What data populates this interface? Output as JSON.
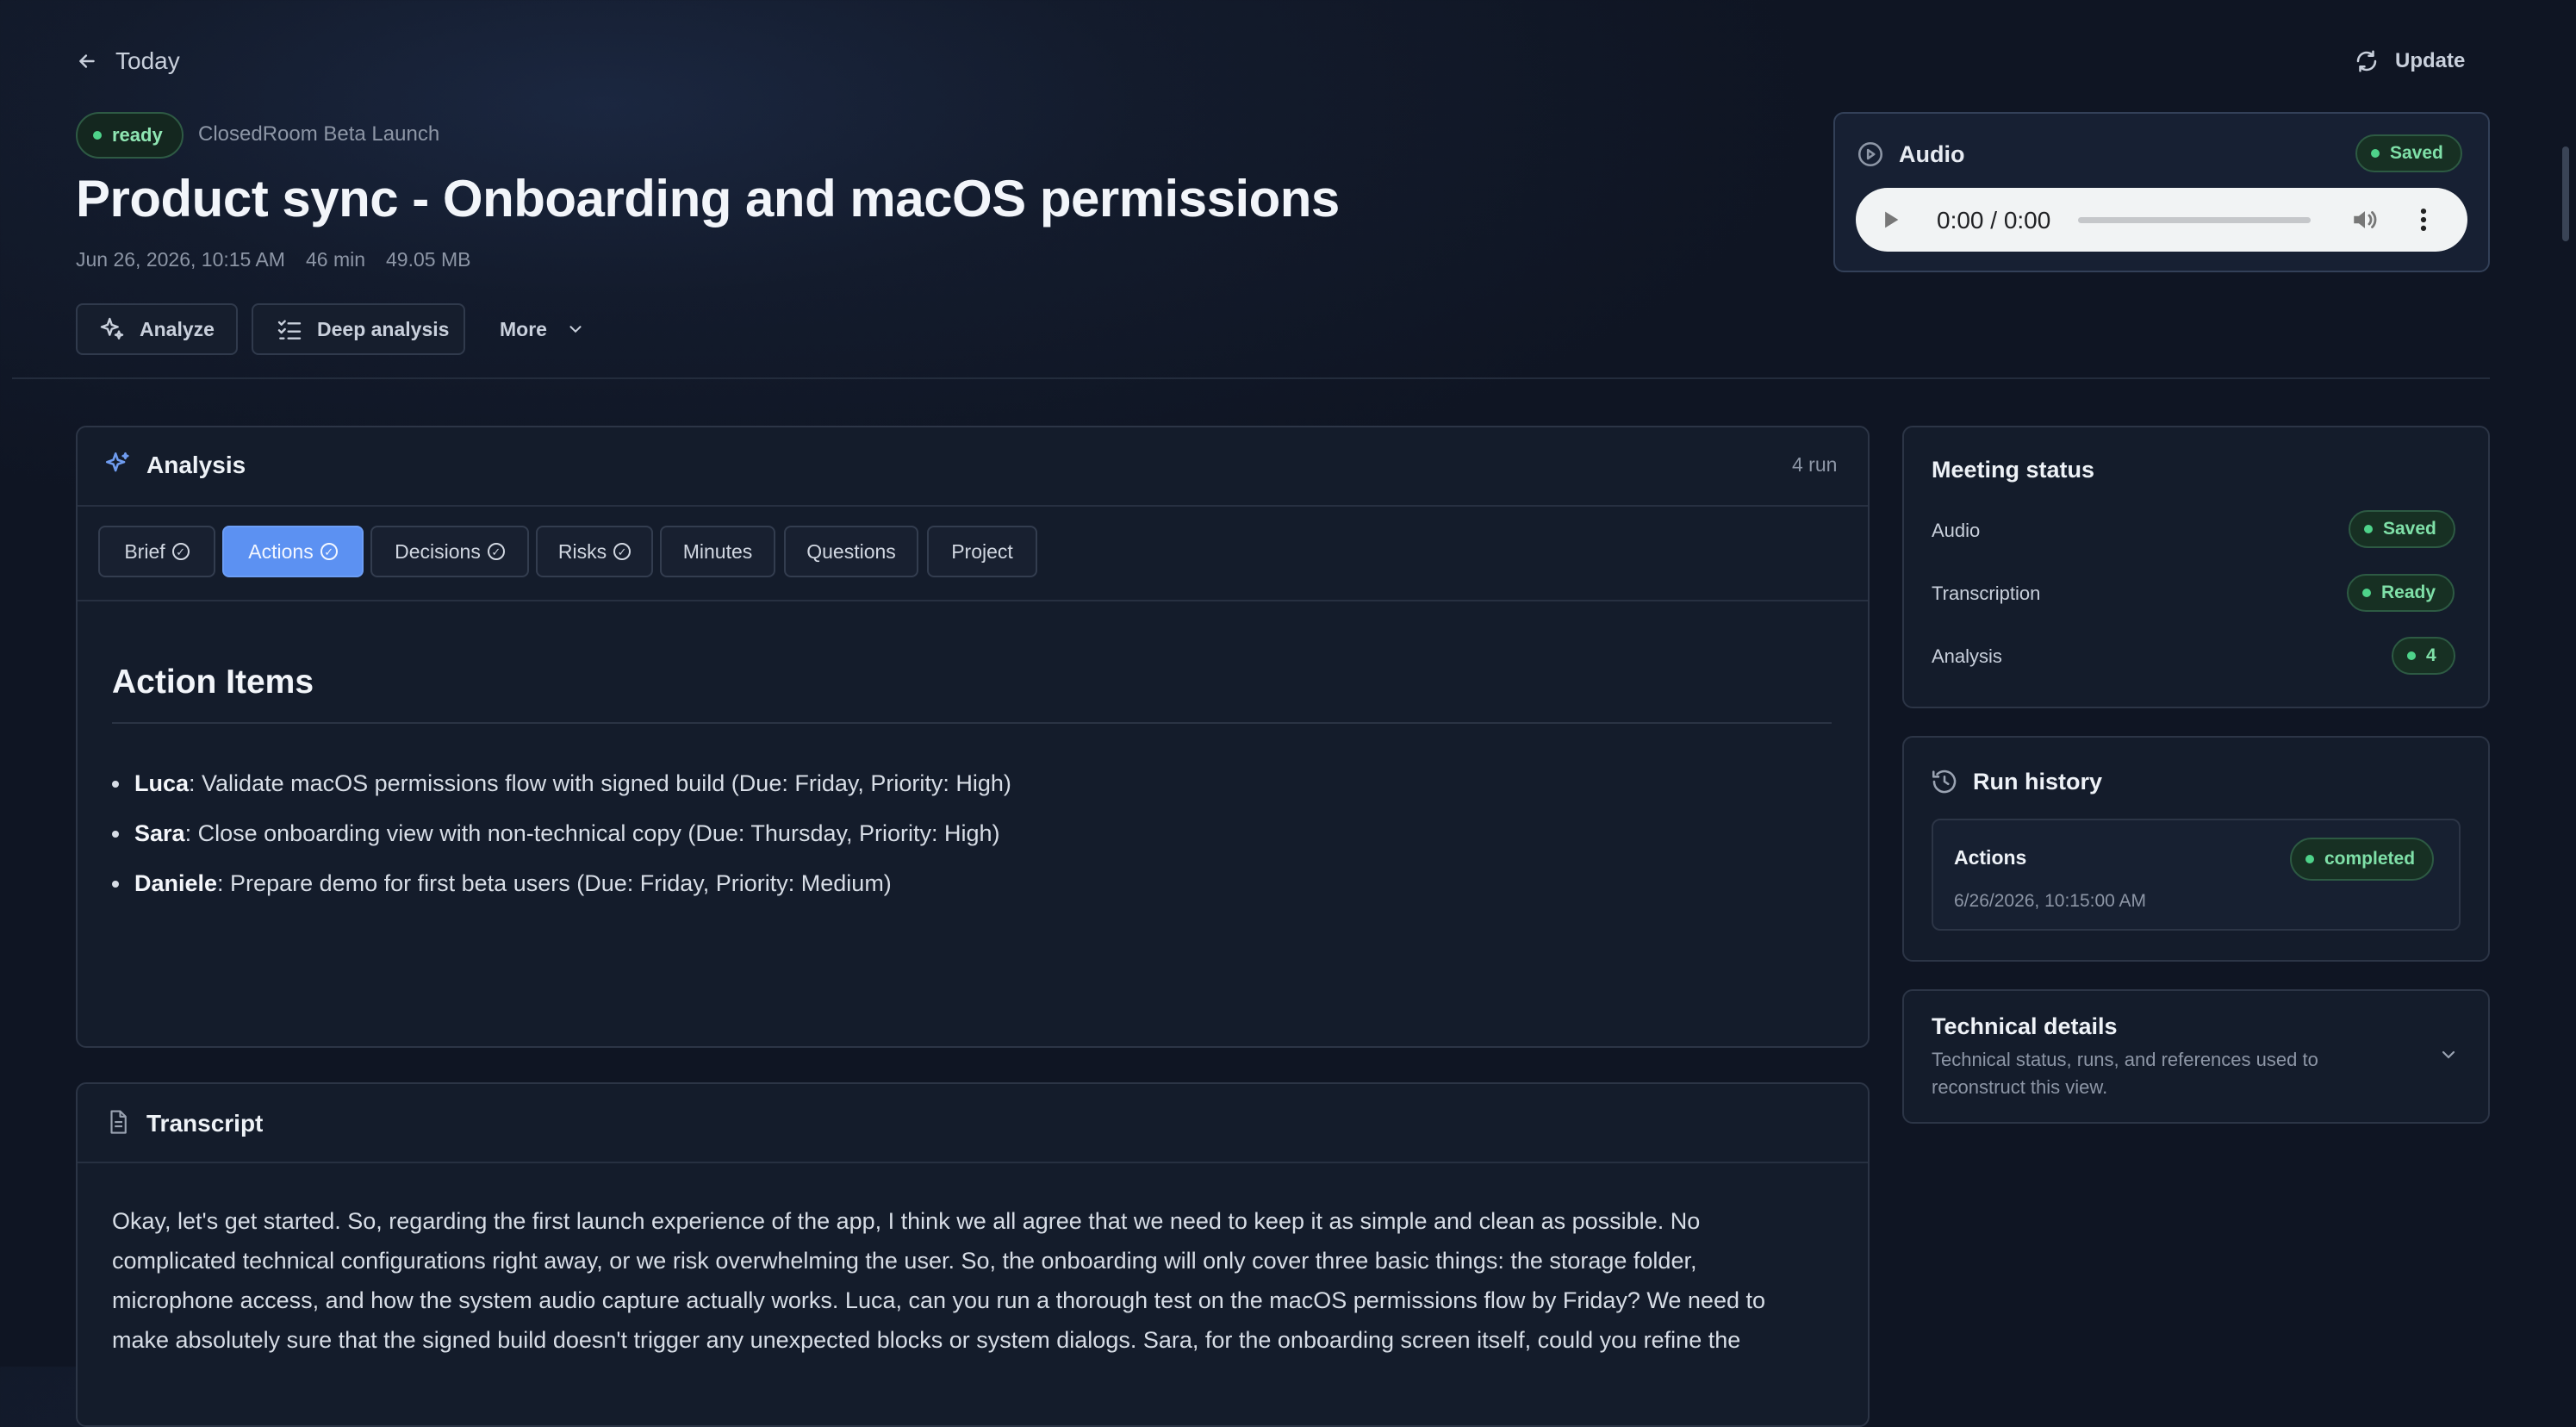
{
  "nav": {
    "back_label": "Today",
    "update_label": "Update"
  },
  "header": {
    "status": "ready",
    "project": "ClosedRoom Beta Launch",
    "title": "Product sync - Onboarding and macOS permissions",
    "meta": {
      "date": "Jun 26, 2026, 10:15 AM",
      "duration": "46 min",
      "size": "49.05 MB"
    },
    "actions": {
      "analyze": "Analyze",
      "deep": "Deep analysis",
      "more": "More"
    }
  },
  "audio": {
    "title": "Audio",
    "badge": "Saved",
    "time": "0:00 / 0:00"
  },
  "analysis": {
    "title": "Analysis",
    "runs": "4 run",
    "tabs": [
      "Brief",
      "Actions",
      "Decisions",
      "Risks",
      "Minutes",
      "Questions",
      "Project"
    ],
    "active_tab": "Actions",
    "heading": "Action Items",
    "items": [
      {
        "name": "Luca",
        "text": ": Validate macOS permissions flow with signed build (Due: Friday, Priority: High)"
      },
      {
        "name": "Sara",
        "text": ": Close onboarding view with non-technical copy (Due: Thursday, Priority: High)"
      },
      {
        "name": "Daniele",
        "text": ": Prepare demo for first beta users (Due: Friday, Priority: Medium)"
      }
    ]
  },
  "transcript": {
    "title": "Transcript",
    "lines": [
      "Okay, let's get started. So, regarding the first launch experience of the app, I think we all agree that we need to keep it as simple and clean as possible. No",
      "complicated technical configurations right away, or we risk overwhelming the user. So, the onboarding will only cover three basic things: the storage folder,",
      "microphone access, and how the system audio capture actually works. Luca, can you run a thorough test on the macOS permissions flow by Friday? We need to",
      "make absolutely sure that the signed build doesn't trigger any unexpected blocks or system dialogs. Sara, for the onboarding screen itself, could you refine the"
    ]
  },
  "status": {
    "title": "Meeting status",
    "rows": [
      {
        "label": "Audio",
        "value": "Saved"
      },
      {
        "label": "Transcription",
        "value": "Ready"
      },
      {
        "label": "Analysis",
        "value": "4"
      }
    ]
  },
  "history": {
    "title": "Run history",
    "run": {
      "name": "Actions",
      "status": "completed",
      "time": "6/26/2026, 10:15:00 AM"
    }
  },
  "tech": {
    "title": "Technical details",
    "desc1": "Technical status, runs, and references used to",
    "desc2": "reconstruct this view."
  },
  "colors": {
    "accent": "#5c91f2",
    "success": "#4ed38a",
    "background": "#131b2c"
  }
}
